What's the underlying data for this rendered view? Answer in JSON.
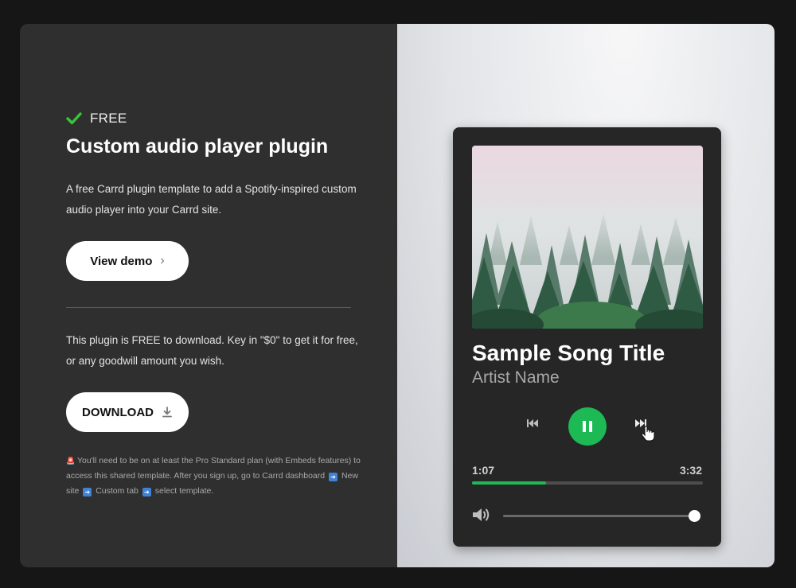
{
  "badge": {
    "icon": "checkmark-icon",
    "color": "#3ac33a",
    "text": "FREE"
  },
  "title": "Custom audio player plugin",
  "description": "A free Carrd plugin template to add a Spotify-inspired custom audio player into your Carrd site.",
  "view_demo": {
    "label": "View demo",
    "icon": "chevron-right-icon"
  },
  "plugin_text": "This plugin is FREE to download. Key in \"$0\" to get it for free, or any goodwill amount you wish.",
  "download": {
    "label": "DOWNLOAD",
    "icon": "download-icon"
  },
  "note": {
    "part1": "You'll need to be on at least the Pro Standard plan (with Embeds features) to access this shared template. After you sign up, go to Carrd dashboard",
    "part2": "New site",
    "part3": "Custom tab",
    "part4": "select template."
  },
  "player": {
    "song_title": "Sample Song Title",
    "artist": "Artist Name",
    "current_time": "1:07",
    "total_time": "3:32",
    "progress": 0.32,
    "volume": 1.0,
    "accent": "#1db954",
    "artwork": "misty-forest-artwork"
  }
}
